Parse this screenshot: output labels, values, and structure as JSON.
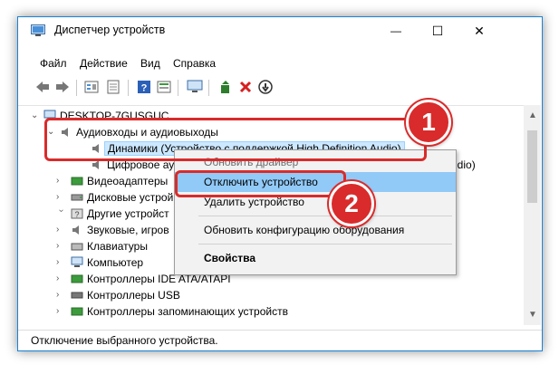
{
  "window": {
    "title": "Диспетчер устройств",
    "minimize_glyph": "—",
    "maximize_glyph": "☐",
    "close_glyph": "✕"
  },
  "menu": [
    "Файл",
    "Действие",
    "Вид",
    "Справка"
  ],
  "toolbar": {
    "icons": [
      "back-icon",
      "forward-icon",
      "properties-view-icon",
      "properties-icon",
      "help-icon",
      "details-icon",
      "monitor-icon",
      "update-driver-icon",
      "uninstall-icon",
      "disable-icon"
    ]
  },
  "tree": {
    "root": "DESKTOP-7GUSGUC",
    "audio_category": "Аудиовходы и аудиовыходы",
    "speakers": "Динамики (Устройство с поддержкой High Definition Audio)",
    "digital_partial": "Цифровое ау",
    "digital_tail": "udio)",
    "video": "Видеоадаптеры",
    "disk": "Дисковые устрой",
    "other": "Другие устройст",
    "sound": "Звуковые, игров",
    "keyboards": "Клавиатуры",
    "computer": "Компьютер",
    "ide": "Контроллеры IDE ATA/ATAPI",
    "usb": "Контроллеры USB",
    "storage": "Контроллеры запоминающих устройств"
  },
  "context_menu": {
    "update_driver": "Обновить драйвер",
    "disable_device": "Отключить устройство",
    "uninstall_device": "Удалить устройство",
    "scan_hardware": "Обновить конфигурацию оборудования",
    "properties": "Свойства"
  },
  "status_text": "Отключение выбранного устройства.",
  "annotations": {
    "badge1": "1",
    "badge2": "2"
  },
  "colors": {
    "accent_red": "#d92b2b",
    "selection_blue": "#cce8ff",
    "window_border": "#1883d7"
  }
}
